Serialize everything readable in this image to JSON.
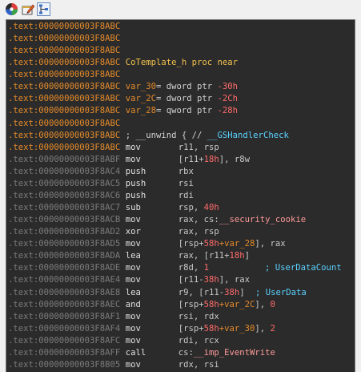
{
  "toolbar": {
    "buttons": [
      {
        "name": "graph-overview",
        "icon": "colored-circle-icon"
      },
      {
        "name": "edit",
        "icon": "pencil-window-icon"
      },
      {
        "name": "graph-view",
        "icon": "graph-icon"
      }
    ]
  },
  "disasm": {
    "header_lines": [
      ".text:00000000003F8ABC",
      ".text:00000000003F8ABC",
      ".text:00000000003F8ABC",
      ".text:00000000003F8ABC",
      ".text:00000000003F8ABC",
      ".text:00000000003F8ABC",
      ".text:00000000003F8ABC",
      ".text:00000000003F8ABC",
      ".text:00000000003F8ABC",
      ".text:00000000003F8ABC"
    ],
    "proc_name": "CoTemplate_h",
    "proc_kw": "proc near",
    "vars": [
      {
        "name": "var_30",
        "type": "= dword ptr ",
        "offset": "-30h"
      },
      {
        "name": "var_2C",
        "type": "= dword ptr ",
        "offset": "-2Ch"
      },
      {
        "name": "var_28",
        "type": "= qword ptr ",
        "offset": "-28h"
      }
    ],
    "unwind": {
      "prefix": "; __unwind { // ",
      "handler": "__GSHandlerCheck"
    },
    "instructions": [
      {
        "addr": ".text:00000000003F8ABC",
        "mn": "mov",
        "op": "r11, rsp"
      },
      {
        "addr": ".text:00000000003F8ABF",
        "mn": "mov",
        "op_a": "[r11+",
        "op_n": "18h",
        "op_b": "], r8w"
      },
      {
        "addr": ".text:00000000003F8AC4",
        "mn": "push",
        "op": "rbx"
      },
      {
        "addr": ".text:00000000003F8AC5",
        "mn": "push",
        "op": "rsi"
      },
      {
        "addr": ".text:00000000003F8AC6",
        "mn": "push",
        "op": "rdi"
      },
      {
        "addr": ".text:00000000003F8AC7",
        "mn": "sub",
        "op_a": "rsp, ",
        "op_n": "40h"
      },
      {
        "addr": ".text:00000000003F8ACB",
        "mn": "mov",
        "op_a": "rax, cs:",
        "op_s": "__security_cookie"
      },
      {
        "addr": ".text:00000000003F8AD2",
        "mn": "xor",
        "op": "rax, rsp"
      },
      {
        "addr": ".text:00000000003F8AD5",
        "mn": "mov",
        "op_a": "[rsp+",
        "op_n": "58h",
        "op_v": "+var_28",
        "op_b": "], rax"
      },
      {
        "addr": ".text:00000000003F8ADA",
        "mn": "lea",
        "op_a": "rax, [r11+",
        "op_n": "18h",
        "op_b": "]"
      },
      {
        "addr": ".text:00000000003F8ADE",
        "mn": "mov",
        "op_a": "r8d, ",
        "op_n": "1",
        "cmt": "; UserDataCount"
      },
      {
        "addr": ".text:00000000003F8AE4",
        "mn": "mov",
        "op_a": "[r11-",
        "op_n": "38h",
        "op_b": "], rax"
      },
      {
        "addr": ".text:00000000003F8AE8",
        "mn": "lea",
        "op_a": "r9, [r11-",
        "op_n": "38h",
        "op_b": "]",
        "cmt": "; UserData"
      },
      {
        "addr": ".text:00000000003F8AEC",
        "mn": "and",
        "op_a": "[rsp+",
        "op_n": "58h",
        "op_v": "+var_2C",
        "op_b": "], ",
        "op_n2": "0"
      },
      {
        "addr": ".text:00000000003F8AF1",
        "mn": "mov",
        "op": "rsi, rdx"
      },
      {
        "addr": ".text:00000000003F8AF4",
        "mn": "mov",
        "op_a": "[rsp+",
        "op_n": "58h",
        "op_v": "+var_30",
        "op_b": "], ",
        "op_n2": "2"
      },
      {
        "addr": ".text:00000000003F8AFC",
        "mn": "mov",
        "op": "rdi, rcx"
      },
      {
        "addr": ".text:00000000003F8AFF",
        "mn": "call",
        "op_a": "cs:",
        "op_s": "__imp_EventWrite"
      },
      {
        "addr": ".text:00000000003F8B05",
        "mn": "mov",
        "op": "rdx, rsi"
      }
    ]
  },
  "colors": {
    "background": "#2b2b2b",
    "address_active": "#e38a2a",
    "address_inactive": "#7b7b7b",
    "number": "#ff6a6a",
    "comment": "#5ad1ff",
    "function": "#f2c14e"
  }
}
